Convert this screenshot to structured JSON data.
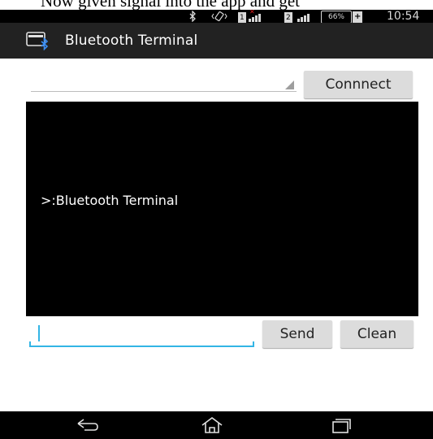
{
  "caption": "Now given signal into the app and get",
  "status_bar": {
    "sim1": "1",
    "sim2": "2",
    "battery": "66%",
    "charging": "+",
    "time": "10:54",
    "icons": [
      "bluetooth-icon",
      "vibrate-icon",
      "signal-icon",
      "battery-icon"
    ]
  },
  "action_bar": {
    "title": "Bluetooth Terminal",
    "icon": "bluetooth-terminal-app-icon"
  },
  "device_spinner": {
    "selected": ""
  },
  "buttons": {
    "connect": "Connnect",
    "send": "Send",
    "clean": "Clean"
  },
  "terminal": {
    "output": ">:Bluetooth Terminal"
  },
  "message_input": {
    "value": ""
  },
  "nav_bar": {
    "icons": [
      "back-icon",
      "home-icon",
      "recent-apps-icon"
    ]
  },
  "colors": {
    "action_bar": "#222222",
    "terminal_bg": "#000000",
    "accent": "#33b5e5",
    "button_bg": "#dcdcdc"
  }
}
